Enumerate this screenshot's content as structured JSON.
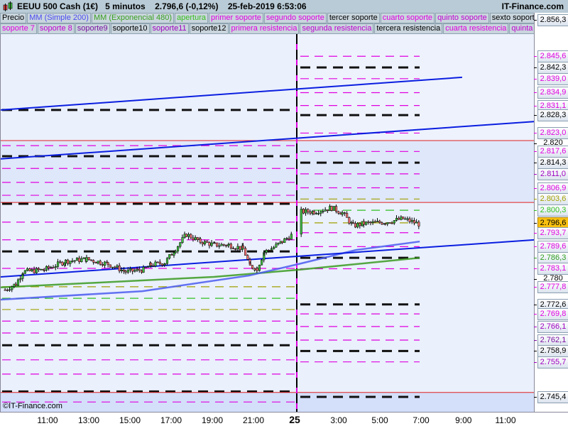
{
  "header": {
    "title": "EEUU 500 Cash (1€)",
    "timeframe": "5 minutos",
    "price": "2.796,6 (-0,12%)",
    "datetime": "25-feb-2019 6:53:06",
    "brand": "IT-Finance.com"
  },
  "legend": {
    "row1": [
      {
        "label": "Precio",
        "color": "#000000"
      },
      {
        "label": "MM (Simple 200)",
        "color": "#4a4af0"
      },
      {
        "label": "MM (Exponencial 480)",
        "color": "#3aa020"
      },
      {
        "label": "apertura",
        "color": "#3ac020"
      },
      {
        "label": "primer soporte",
        "color": "#e000e0"
      },
      {
        "label": "segundo soporte",
        "color": "#e000e0"
      },
      {
        "label": "tercer soporte",
        "color": "#000000"
      },
      {
        "label": "cuarto soporte",
        "color": "#e000e0"
      },
      {
        "label": "quinto soporte",
        "color": "#c000d0"
      },
      {
        "label": "sexto soporte",
        "color": "#000000"
      }
    ],
    "row2": [
      {
        "label": "soporte 7",
        "color": "#e000e0"
      },
      {
        "label": "soporte 8",
        "color": "#c000d0"
      },
      {
        "label": "soporte9",
        "color": "#7a10a0"
      },
      {
        "label": "soporte10",
        "color": "#000000"
      },
      {
        "label": "soporte11",
        "color": "#a000c0"
      },
      {
        "label": "soporte12",
        "color": "#000000"
      },
      {
        "label": "primera resistencia",
        "color": "#e000e0"
      },
      {
        "label": "segunda resistencia",
        "color": "#c000d0"
      },
      {
        "label": "tercera resistencia",
        "color": "#000000"
      },
      {
        "label": "cuarta resistencia",
        "color": "#e000e0"
      },
      {
        "label": "quinta resi",
        "color": "#c000d0"
      }
    ]
  },
  "copyright": "©IT-Finance.com",
  "chart_data": {
    "type": "candlestick",
    "ylim": [
      2743.5,
      2856.3
    ],
    "price_labels": [
      {
        "v": 2856.3,
        "t": "2.856,3",
        "c": "#000000"
      },
      {
        "v": 2845.6,
        "t": "2.845,6",
        "c": "#e000e0"
      },
      {
        "v": 2842.3,
        "t": "2.842,3",
        "c": "#000000"
      },
      {
        "v": 2839.0,
        "t": "2.839,0",
        "c": "#e000e0"
      },
      {
        "v": 2834.9,
        "t": "2.834,9",
        "c": "#e000e0"
      },
      {
        "v": 2831.1,
        "t": "2.831,1",
        "c": "#e000e0"
      },
      {
        "v": 2828.3,
        "t": "2.828,3",
        "c": "#000000"
      },
      {
        "v": 2823.0,
        "t": "2.823,0",
        "c": "#e000e0"
      },
      {
        "v": 2820,
        "t": "2.820",
        "c": "#000000",
        "plain": true
      },
      {
        "v": 2817.6,
        "t": "2.817,6",
        "c": "#e000e0"
      },
      {
        "v": 2814.3,
        "t": "2.814,3",
        "c": "#000000"
      },
      {
        "v": 2811.0,
        "t": "2.811,0",
        "c": "#a000c0"
      },
      {
        "v": 2806.9,
        "t": "2.806,9",
        "c": "#e000e0"
      },
      {
        "v": 2803.6,
        "t": "2.803,6",
        "c": "#a0a000"
      },
      {
        "v": 2800.3,
        "t": "2.800,3",
        "c": "#30c020"
      },
      {
        "v": 2796.6,
        "t": "2.796,6",
        "c": "#000000",
        "current": true
      },
      {
        "v": 2793.7,
        "t": "2.793,7",
        "c": "#e000e0"
      },
      {
        "v": 2789.6,
        "t": "2.789,6",
        "c": "#e000e0"
      },
      {
        "v": 2786.3,
        "t": "2.786,3",
        "c": "#30a020"
      },
      {
        "v": 2783.1,
        "t": "2.783,1",
        "c": "#e000e0"
      },
      {
        "v": 2780,
        "t": "2.780",
        "c": "#000000",
        "plain": true
      },
      {
        "v": 2777.8,
        "t": "2.777,8",
        "c": "#e000e0"
      },
      {
        "v": 2772.6,
        "t": "2.772,6",
        "c": "#000000"
      },
      {
        "v": 2769.8,
        "t": "2.769,8",
        "c": "#e000e0"
      },
      {
        "v": 2766.1,
        "t": "2.766,1",
        "c": "#a000c0"
      },
      {
        "v": 2762.1,
        "t": "2.762,1",
        "c": "#7a10a0"
      },
      {
        "v": 2758.9,
        "t": "2.758,9",
        "c": "#000000"
      },
      {
        "v": 2755.7,
        "t": "2.755,7",
        "c": "#a000c0"
      },
      {
        "v": 2745.4,
        "t": "2.745,4",
        "c": "#000000"
      }
    ],
    "left_levels": [
      [
        2829.8,
        "k"
      ],
      [
        2819.3,
        "m"
      ],
      [
        2816.2,
        "k"
      ],
      [
        2812.6,
        "m"
      ],
      [
        2808.5,
        "m"
      ],
      [
        2804.7,
        "m"
      ],
      [
        2802.2,
        "k"
      ],
      [
        2796.8,
        "m"
      ],
      [
        2791.6,
        "m"
      ],
      [
        2788.2,
        "k"
      ],
      [
        2783.2,
        "m"
      ],
      [
        2777.8,
        "o"
      ],
      [
        2774.4,
        "g"
      ],
      [
        2771.1,
        "o"
      ],
      [
        2767.7,
        "m"
      ],
      [
        2764.2,
        "m"
      ],
      [
        2760.6,
        "k"
      ],
      [
        2756.3,
        "m"
      ],
      [
        2752.1,
        "m"
      ],
      [
        2747.0,
        "k"
      ],
      [
        2743.9,
        "m"
      ]
    ],
    "right_levels": [
      [
        2845.6,
        "m"
      ],
      [
        2842.3,
        "k"
      ],
      [
        2839.0,
        "m"
      ],
      [
        2834.9,
        "m"
      ],
      [
        2831.1,
        "m"
      ],
      [
        2828.3,
        "k"
      ],
      [
        2823.0,
        "m"
      ],
      [
        2817.6,
        "m"
      ],
      [
        2814.3,
        "k"
      ],
      [
        2811.0,
        "m"
      ],
      [
        2806.9,
        "m"
      ],
      [
        2803.6,
        "o"
      ],
      [
        2800.3,
        "g"
      ],
      [
        2796.6,
        "o"
      ],
      [
        2793.7,
        "m"
      ],
      [
        2789.6,
        "m"
      ],
      [
        2786.3,
        "k"
      ],
      [
        2783.1,
        "m"
      ],
      [
        2772.6,
        "k"
      ],
      [
        2769.8,
        "m"
      ],
      [
        2766.1,
        "m"
      ],
      [
        2762.1,
        "m"
      ],
      [
        2758.9,
        "k"
      ],
      [
        2755.7,
        "m"
      ],
      [
        2745.4,
        "k"
      ]
    ],
    "red_levels": [
      2820.8,
      2802.6,
      2746.7
    ],
    "trendlines": [
      [
        [
          -1.16,
          2829.8
        ],
        [
          10.05,
          2839.4
        ]
      ],
      [
        [
          -1.16,
          2815.4
        ],
        [
          11.81,
          2826.4
        ]
      ],
      [
        [
          -1.16,
          2780.7
        ],
        [
          11.81,
          2791.6
        ]
      ]
    ],
    "ma200": [
      [
        -1.16,
        2774.0
      ],
      [
        2.29,
        2776.5
      ],
      [
        4.88,
        2781.1
      ],
      [
        6.09,
        2784.5
      ],
      [
        7.47,
        2788.6
      ],
      [
        9.02,
        2791.1
      ]
    ],
    "ma480": [
      [
        -1.16,
        2777.6
      ],
      [
        4.02,
        2780.7
      ],
      [
        6.09,
        2782.8
      ],
      [
        9.02,
        2786.3
      ]
    ],
    "price_path": [
      [
        -1.07,
        2776.9
      ],
      [
        -0.81,
        2778.6
      ],
      [
        -0.64,
        2782.2
      ],
      [
        -0.12,
        2782.8
      ],
      [
        0.4,
        2785.3
      ],
      [
        0.91,
        2785.9
      ],
      [
        1.43,
        2784.5
      ],
      [
        1.86,
        2782.2
      ],
      [
        2.29,
        2782.8
      ],
      [
        2.47,
        2784.2
      ],
      [
        2.81,
        2784.9
      ],
      [
        3.07,
        2789.0
      ],
      [
        3.33,
        2793.2
      ],
      [
        3.67,
        2791.1
      ],
      [
        4.02,
        2790.1
      ],
      [
        4.36,
        2790.1
      ],
      [
        4.71,
        2789.0
      ],
      [
        4.88,
        2783.8
      ],
      [
        5.05,
        2783.2
      ],
      [
        5.22,
        2788.0
      ],
      [
        5.4,
        2789.0
      ],
      [
        5.66,
        2791.1
      ],
      [
        5.91,
        2793.2
      ],
      [
        6.12,
        2799.9
      ],
      [
        6.43,
        2799.9
      ],
      [
        6.86,
        2801.0
      ],
      [
        7.12,
        2799.5
      ],
      [
        7.38,
        2795.7
      ],
      [
        7.64,
        2796.4
      ],
      [
        8.16,
        2796.8
      ],
      [
        8.59,
        2797.8
      ],
      [
        9.02,
        2796.1
      ]
    ],
    "session_break": 6.0,
    "x_ticks": [
      {
        "t": 0,
        "label": "11:00"
      },
      {
        "t": 1,
        "label": "13:00"
      },
      {
        "t": 2,
        "label": "15:00"
      },
      {
        "t": 3,
        "label": "17:00"
      },
      {
        "t": 4,
        "label": "19:00"
      },
      {
        "t": 5,
        "label": "21:00"
      },
      {
        "t": 6,
        "label": "25",
        "bold": true
      },
      {
        "t": 7.07,
        "label": "3:00"
      },
      {
        "t": 8.07,
        "label": "5:00"
      },
      {
        "t": 9.07,
        "label": "7:00"
      },
      {
        "t": 10.1,
        "label": "9:00"
      },
      {
        "t": 11.12,
        "label": "11:00"
      }
    ]
  }
}
